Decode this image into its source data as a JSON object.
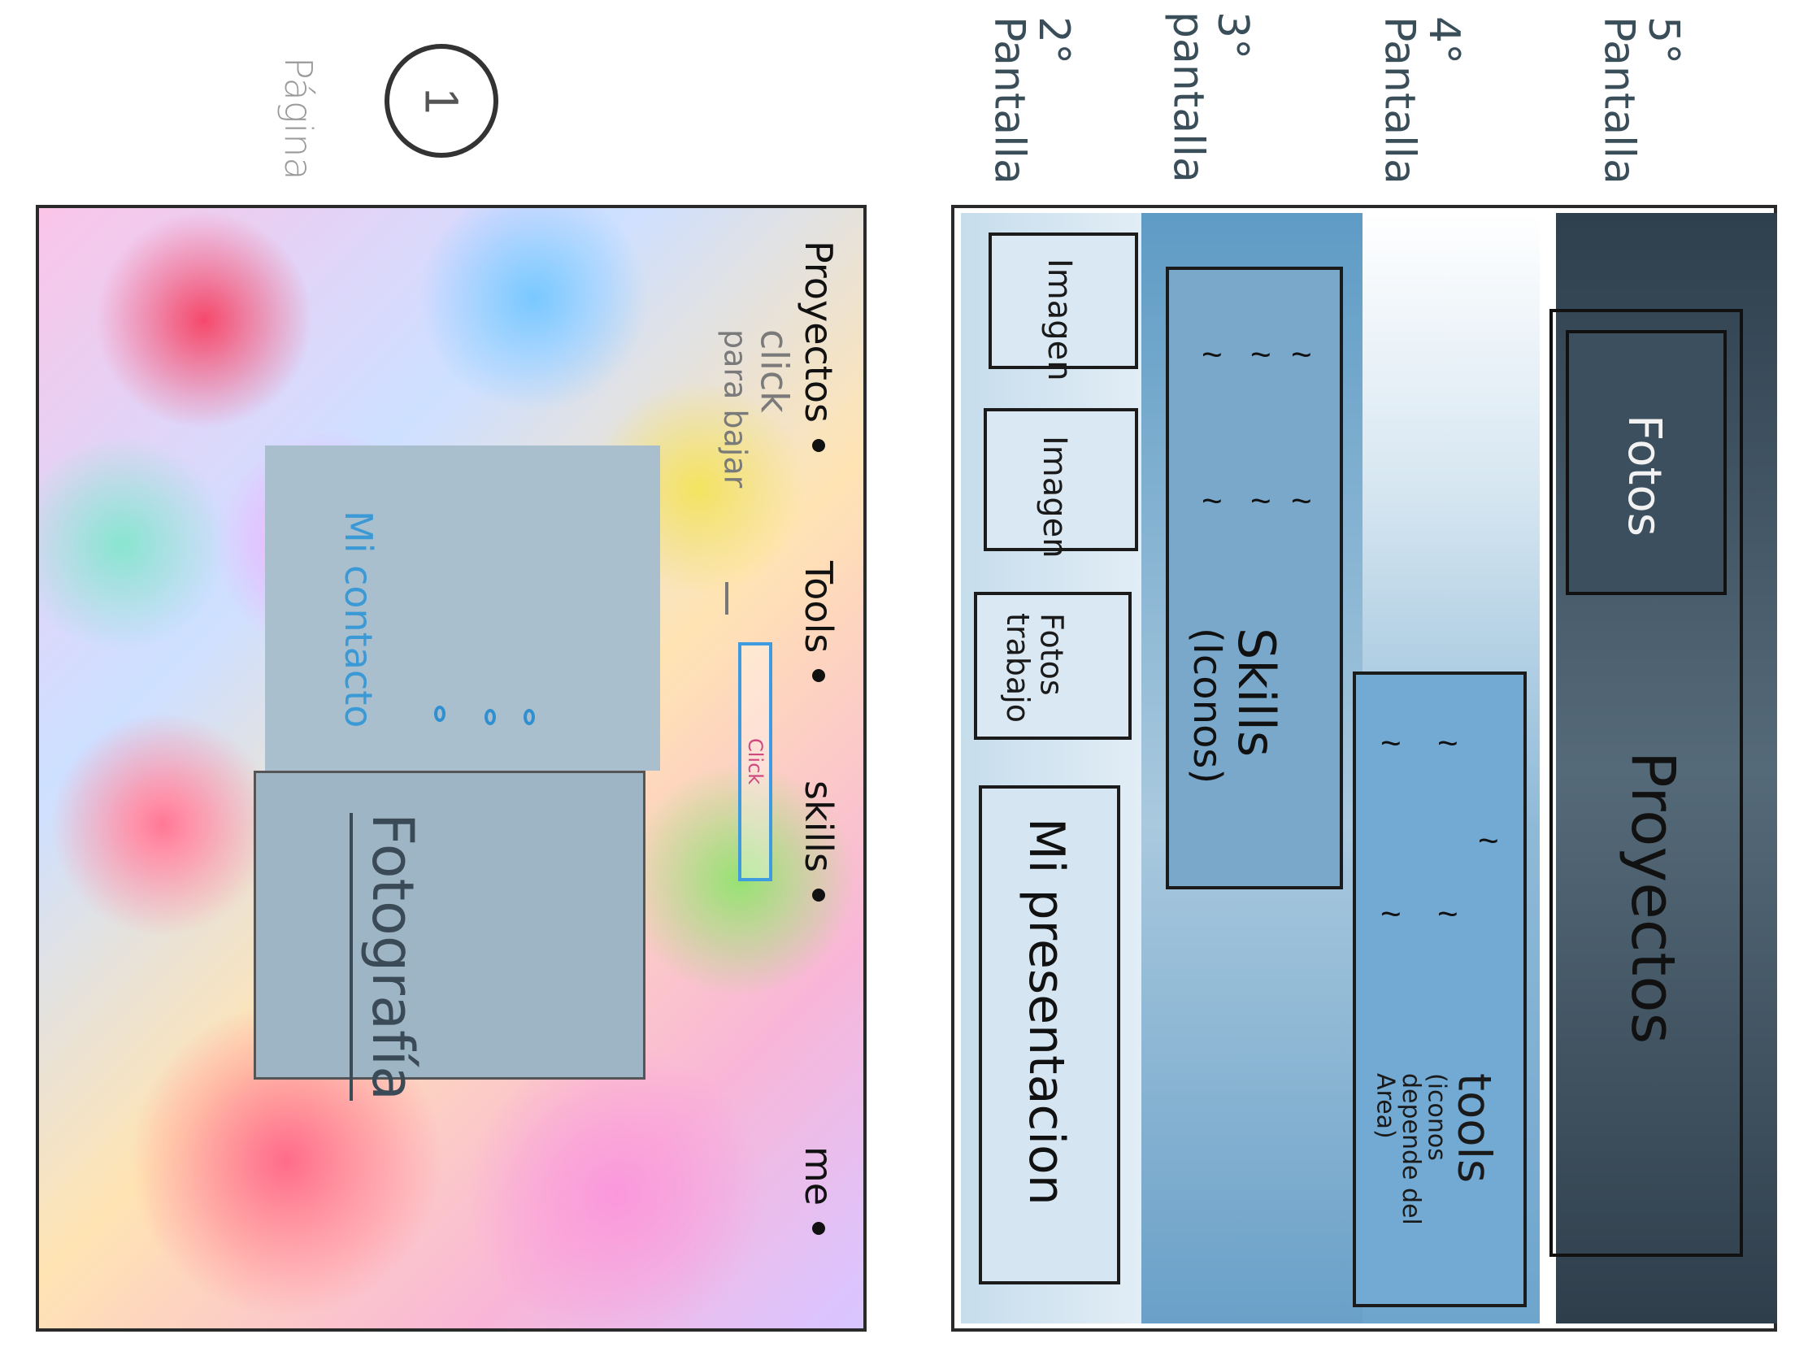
{
  "page": {
    "label": "Página",
    "number": "1"
  },
  "left_panel": {
    "photo_label": "Fotografía",
    "contact_label": "Mi contacto",
    "click_button_label": "Click",
    "click_note_line1": "click",
    "click_note_line2": "para bajar",
    "nav": [
      {
        "label": "me"
      },
      {
        "label": "skills"
      },
      {
        "label": "Tools"
      },
      {
        "label": "Proyectos"
      }
    ]
  },
  "right_panel": {
    "screen_labels": [
      {
        "number": "2°",
        "word": "Pantalla"
      },
      {
        "number": "3°",
        "word": "pantalla"
      },
      {
        "number": "4°",
        "word": "Pantalla"
      },
      {
        "number": "5°",
        "word": "Pantalla"
      }
    ],
    "mi_presentacion": "Mi presentacion",
    "fotos_trabajo_line1": "Fotos",
    "fotos_trabajo_line2": "trabajo",
    "imagen_1": "Imagen",
    "imagen_2": "Imagen",
    "skills_title": "Skills",
    "skills_subtitle": "(Iconos)",
    "tools_title": "tools",
    "tools_subtitle_line1": "(iconos",
    "tools_subtitle_line2": "depende del",
    "tools_subtitle_line3": "Area)",
    "proyectos": "Proyectos",
    "fotos": "Fotos"
  },
  "colors": {
    "screen2": "#c6ddec",
    "screen3": "#79a8cb",
    "screen4": "#72aad4",
    "screen5": "#3b4f5e",
    "contact_accent": "#3b9ad6"
  }
}
